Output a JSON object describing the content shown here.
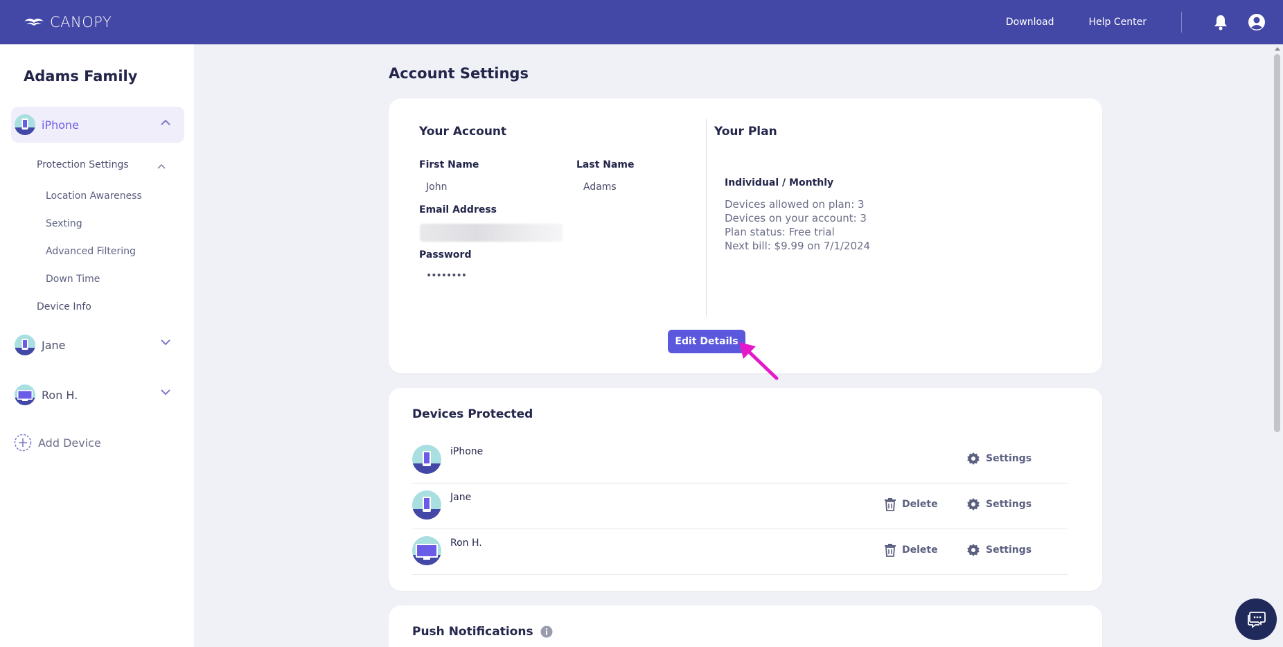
{
  "app": {
    "logo_text": "CANOPY"
  },
  "topnav": {
    "download": "Download",
    "help_center": "Help Center"
  },
  "sidebar": {
    "family_name": "Adams Family",
    "devices": [
      {
        "name": "iPhone",
        "expanded": true
      },
      {
        "name": "Jane",
        "expanded": false
      },
      {
        "name": "Ron H.",
        "expanded": false
      }
    ],
    "protection_settings": "Protection Settings",
    "sub_items": [
      "Location Awareness",
      "Sexting",
      "Advanced Filtering",
      "Down Time"
    ],
    "device_info": "Device Info",
    "add_device": "Add Device"
  },
  "main": {
    "title": "Account Settings",
    "account": {
      "title": "Your Account",
      "first_name_label": "First Name",
      "first_name": "John",
      "last_name_label": "Last Name",
      "last_name": "Adams",
      "email_label": "Email Address",
      "password_label": "Password",
      "password": "••••••••"
    },
    "plan": {
      "title": "Your Plan",
      "name": "Individual / Monthly",
      "lines": [
        "Devices allowed on plan: 3",
        "Devices on your account: 3",
        "Plan status: Free trial",
        "Next bill: $9.99 on 7/1/2024"
      ]
    },
    "edit_button": "Edit Details",
    "devices_protected": {
      "title": "Devices Protected",
      "rows": [
        {
          "name": "iPhone",
          "type": "phone"
        },
        {
          "name": "Jane",
          "type": "phone"
        },
        {
          "name": "Ron H.",
          "type": "computer"
        }
      ],
      "delete_label": "Delete",
      "settings_label": "Settings"
    },
    "push_notifications": {
      "title": "Push Notifications"
    }
  },
  "colors": {
    "header": "#4347a6",
    "accent": "#5b58de",
    "annotation_arrow": "#e619c8"
  }
}
